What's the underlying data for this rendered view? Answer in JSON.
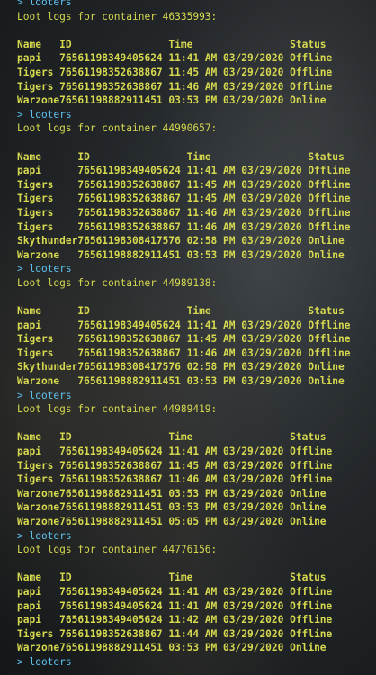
{
  "console": {
    "blocks": [
      {
        "command": "> looters",
        "title": "Loot logs for container 46335993:",
        "headers": [
          "Name",
          "ID",
          "Time",
          "Status"
        ],
        "name_width": 7,
        "rows": [
          [
            "papi",
            "76561198349405624",
            "11:41 AM 03/29/2020",
            "Offline"
          ],
          [
            "Tigers",
            "76561198352638867",
            "11:45 AM 03/29/2020",
            "Offline"
          ],
          [
            "Tigers",
            "76561198352638867",
            "11:46 AM 03/29/2020",
            "Offline"
          ],
          [
            "Warzone",
            "76561198882911451",
            "03:53 PM 03/29/2020",
            "Online"
          ]
        ]
      },
      {
        "command": "> looters",
        "title": "Loot logs for container 44990657:",
        "headers": [
          "Name",
          "ID",
          "Time",
          "Status"
        ],
        "name_width": 10,
        "rows": [
          [
            "papi",
            "76561198349405624",
            "11:41 AM 03/29/2020",
            "Offline"
          ],
          [
            "Tigers",
            "76561198352638867",
            "11:45 AM 03/29/2020",
            "Offline"
          ],
          [
            "Tigers",
            "76561198352638867",
            "11:45 AM 03/29/2020",
            "Offline"
          ],
          [
            "Tigers",
            "76561198352638867",
            "11:46 AM 03/29/2020",
            "Offline"
          ],
          [
            "Tigers",
            "76561198352638867",
            "11:46 AM 03/29/2020",
            "Offline"
          ],
          [
            "Skythunder",
            "76561198308417576",
            "02:58 PM 03/29/2020",
            "Online"
          ],
          [
            "Warzone",
            "76561198882911451",
            "03:53 PM 03/29/2020",
            "Online"
          ]
        ]
      },
      {
        "command": "> looters",
        "title": "Loot logs for container 44989138:",
        "headers": [
          "Name",
          "ID",
          "Time",
          "Status"
        ],
        "name_width": 10,
        "rows": [
          [
            "papi",
            "76561198349405624",
            "11:41 AM 03/29/2020",
            "Offline"
          ],
          [
            "Tigers",
            "76561198352638867",
            "11:45 AM 03/29/2020",
            "Offline"
          ],
          [
            "Tigers",
            "76561198352638867",
            "11:46 AM 03/29/2020",
            "Offline"
          ],
          [
            "Skythunder",
            "76561198308417576",
            "02:58 PM 03/29/2020",
            "Online"
          ],
          [
            "Warzone",
            "76561198882911451",
            "03:53 PM 03/29/2020",
            "Online"
          ]
        ]
      },
      {
        "command": "> looters",
        "title": "Loot logs for container 44989419:",
        "headers": [
          "Name",
          "ID",
          "Time",
          "Status"
        ],
        "name_width": 7,
        "rows": [
          [
            "papi",
            "76561198349405624",
            "11:41 AM 03/29/2020",
            "Offline"
          ],
          [
            "Tigers",
            "76561198352638867",
            "11:45 AM 03/29/2020",
            "Offline"
          ],
          [
            "Tigers",
            "76561198352638867",
            "11:46 AM 03/29/2020",
            "Offline"
          ],
          [
            "Warzone",
            "76561198882911451",
            "03:53 PM 03/29/2020",
            "Online"
          ],
          [
            "Warzone",
            "76561198882911451",
            "03:53 PM 03/29/2020",
            "Online"
          ],
          [
            "Warzone",
            "76561198882911451",
            "05:05 PM 03/29/2020",
            "Online"
          ]
        ]
      },
      {
        "command": "> looters",
        "title": "Loot logs for container 44776156:",
        "headers": [
          "Name",
          "ID",
          "Time",
          "Status"
        ],
        "name_width": 7,
        "rows": [
          [
            "papi",
            "76561198349405624",
            "11:41 AM 03/29/2020",
            "Offline"
          ],
          [
            "papi",
            "76561198349405624",
            "11:41 AM 03/29/2020",
            "Offline"
          ],
          [
            "papi",
            "76561198349405624",
            "11:42 AM 03/29/2020",
            "Offline"
          ],
          [
            "Tigers",
            "76561198352638867",
            "11:44 AM 03/29/2020",
            "Offline"
          ],
          [
            "Warzone",
            "76561198882911451",
            "03:53 PM 03/29/2020",
            "Online"
          ]
        ]
      }
    ],
    "final_command": "> looters"
  },
  "colors": {
    "text": "#d6d94f",
    "command": "#5fc0ee"
  }
}
